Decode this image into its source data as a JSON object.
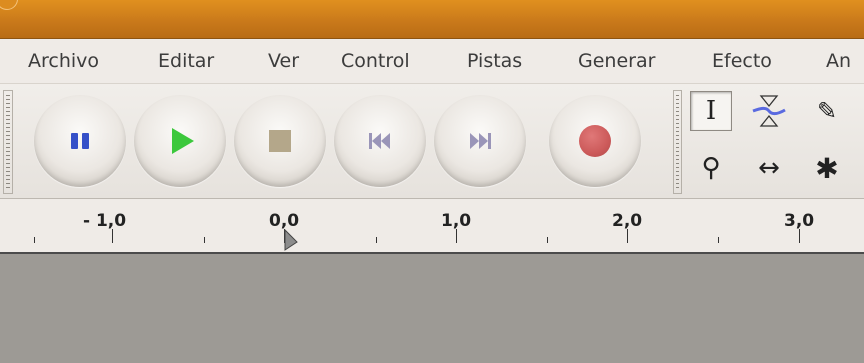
{
  "menu": {
    "items": [
      {
        "label": "Archivo"
      },
      {
        "label": "Editar"
      },
      {
        "label": "Ver"
      },
      {
        "label": "Control"
      },
      {
        "label": "Pistas"
      },
      {
        "label": "Generar"
      },
      {
        "label": "Efecto"
      },
      {
        "label": "An"
      }
    ]
  },
  "transport": {
    "buttons": [
      {
        "name": "pause",
        "icon": "pause-icon",
        "color": "#3550c8"
      },
      {
        "name": "play",
        "icon": "play-icon",
        "color": "#3cc83c"
      },
      {
        "name": "stop",
        "icon": "stop-icon",
        "color": "#b4a78a"
      },
      {
        "name": "skip-start",
        "icon": "skip-start-icon",
        "color": "#9a95b8"
      },
      {
        "name": "skip-end",
        "icon": "skip-end-icon",
        "color": "#9a95b8"
      },
      {
        "name": "record",
        "icon": "record-icon",
        "color": "#cc5a5a"
      }
    ]
  },
  "tools": {
    "items": [
      {
        "name": "selection",
        "icon": "i-beam-icon",
        "glyph": "I",
        "selected": true
      },
      {
        "name": "envelope",
        "icon": "envelope-icon",
        "glyph": "",
        "selected": false
      },
      {
        "name": "draw",
        "icon": "pencil-icon",
        "glyph": "✎",
        "selected": false
      },
      {
        "name": "zoom",
        "icon": "zoom-icon",
        "glyph": "⚲",
        "selected": false
      },
      {
        "name": "time-shift",
        "icon": "time-shift-icon",
        "glyph": "↔",
        "selected": false
      },
      {
        "name": "multi",
        "icon": "multi-tool-icon",
        "glyph": "✱",
        "selected": false
      }
    ]
  },
  "ruler": {
    "labels": [
      "- 1,0",
      "0,0",
      "1,0",
      "2,0",
      "3,0"
    ]
  },
  "colors": {
    "titlebar": "#d48420",
    "track_background": "#9d9a95"
  }
}
